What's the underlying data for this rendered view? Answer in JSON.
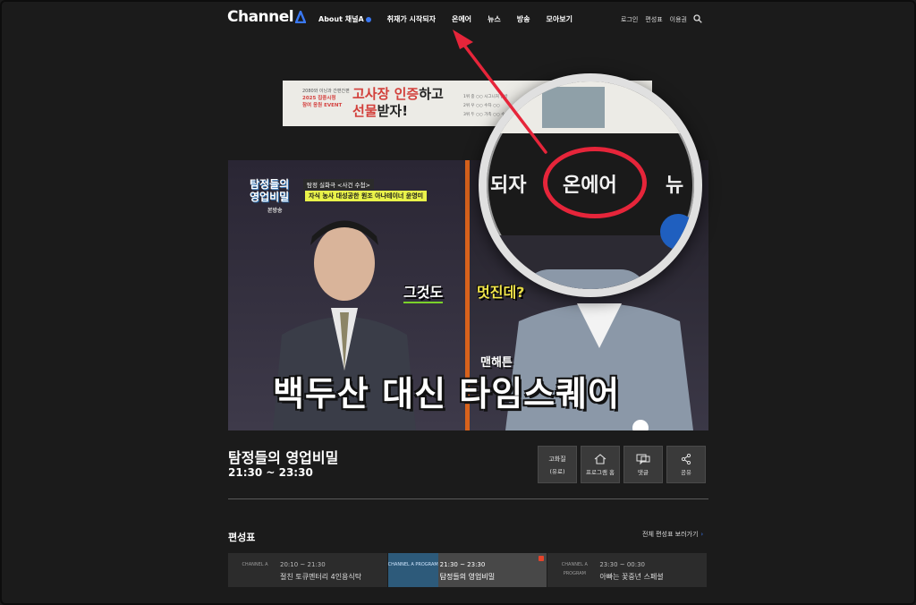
{
  "header": {
    "logo": "Channel",
    "nav": [
      "About 채널A",
      "취재가 시작되자",
      "온에어",
      "뉴스",
      "방송",
      "모아보기"
    ],
    "util": [
      "로그인",
      "편성표",
      "이용권"
    ]
  },
  "banner": {
    "small_lines": [
      "2080와 이닝과 간편간편",
      "2025 집중시청",
      "참여 응원 EVENT"
    ],
    "headline_1a": "고사장",
    "headline_1b": " 인증",
    "headline_1c": "하고",
    "headline_2a": "선물",
    "headline_2b": "받자!",
    "rows": [
      "1위 중 ○○ 시그니처 탐방",
      "2위 우 ○○ 수자 ○○",
      "3위 두 ○○ 가족 ○○ 수"
    ]
  },
  "video": {
    "show_logo_line1": "탐정들의",
    "show_logo_line2": "영업비밀",
    "show_logo_sub": "본방송",
    "caption_top": "탐정 실화극 <사건 수첩>",
    "caption_yellow": "자식 농사 대성공한 원조 아나테이너 윤영미",
    "sub_left": "그것도",
    "sub_right": "멋진데?",
    "sub_mid": "맨해튼",
    "sub_main": "백두산 대신 타임스퀘어"
  },
  "program": {
    "title": "탐정들의 영업비밀",
    "time": "21:30 ~ 23:30"
  },
  "actions": [
    {
      "l1": "고화질",
      "l2": "(유료)"
    },
    {
      "l1": "",
      "l2": "프로그램 홈"
    },
    {
      "l1": "",
      "l2": "댓글"
    },
    {
      "l1": "",
      "l2": "공유"
    }
  ],
  "schedule": {
    "title": "편성표",
    "all_link": "전체 편성표 보러가기",
    "slots": [
      {
        "time": "20:10 ~ 21:30",
        "name": "절친 토큐멘터리 4인용식탁",
        "thumb": "CHANNEL A"
      },
      {
        "time": "21:30 ~ 23:30",
        "name": "탐정들의 영업비밀",
        "thumb": "CHANNEL A PROGRAM"
      },
      {
        "time": "23:30 ~ 00:30",
        "name": "아빠는 꽃중년 스페셜",
        "thumb": "CHANNEL A PROGRAM"
      }
    ]
  },
  "magnifier": {
    "left_word": "되자",
    "center_word": "온에어",
    "right_word": "뉴",
    "bottom_word": "멋진데?"
  },
  "colors": {
    "accent": "#3a78f2",
    "highlight": "#e6253a",
    "live": "#e5432a"
  }
}
